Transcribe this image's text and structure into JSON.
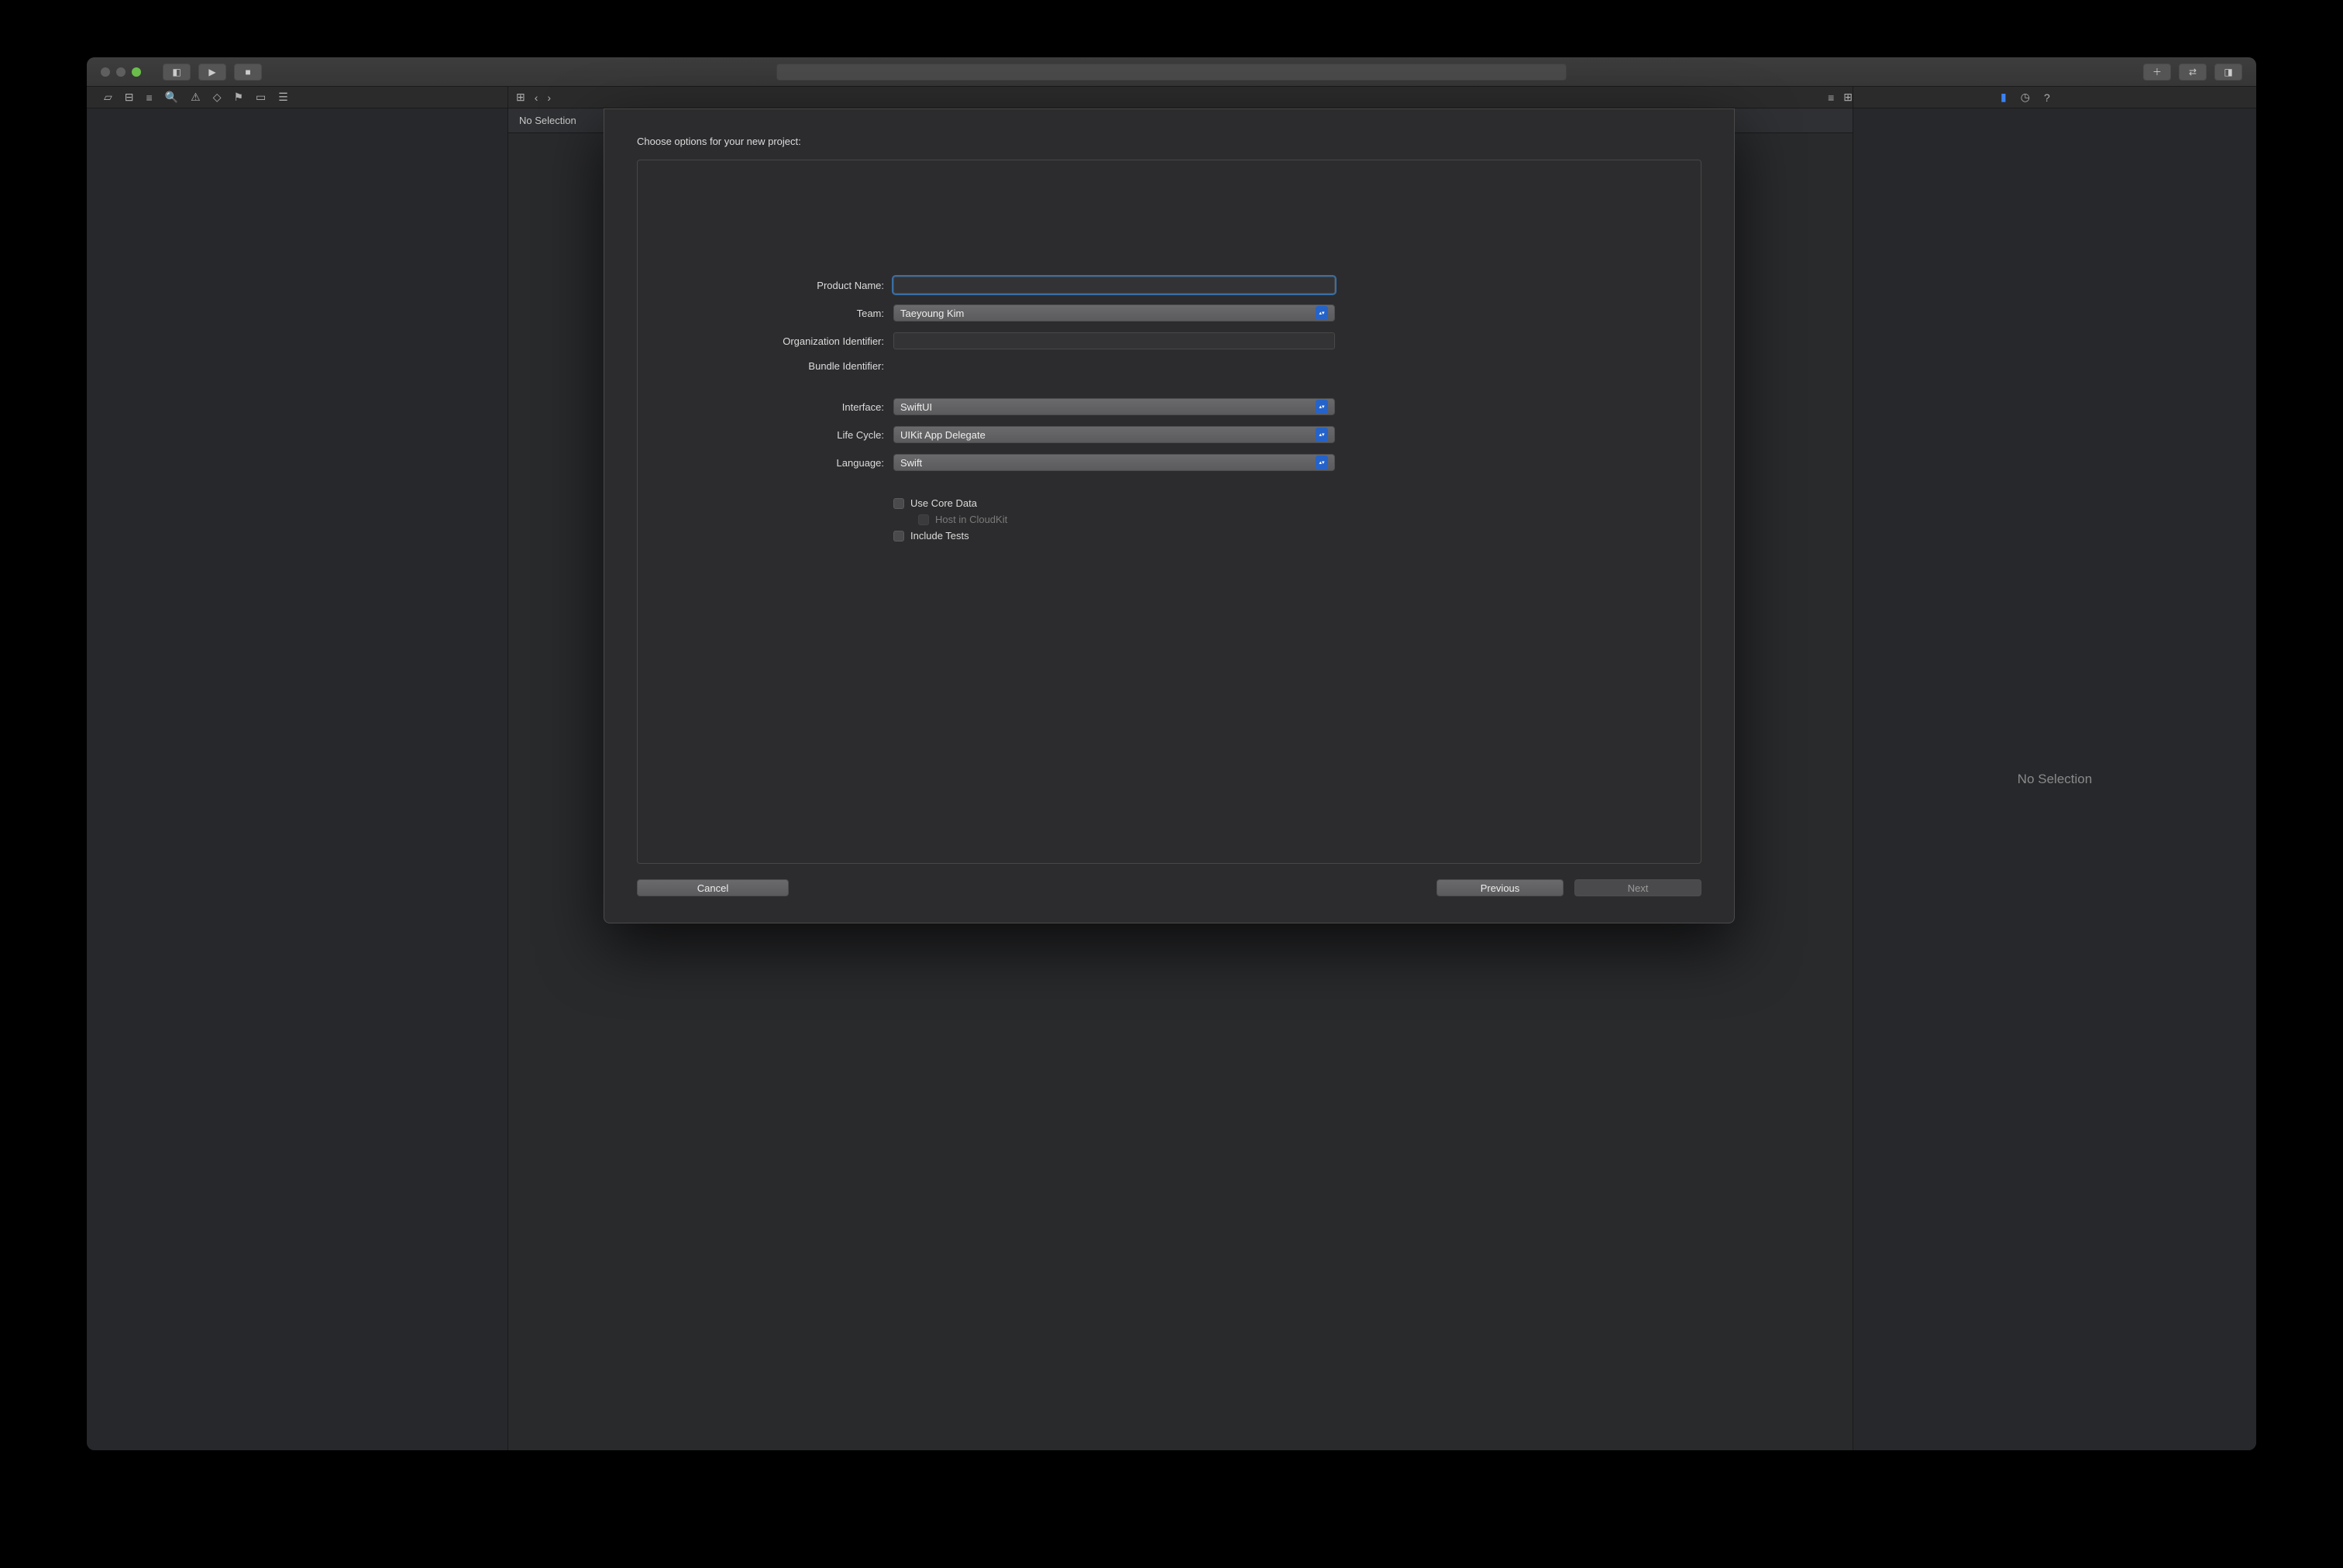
{
  "editor_header": {
    "no_selection": "No Selection"
  },
  "inspector": {
    "no_selection": "No Selection"
  },
  "dialog": {
    "title": "Choose options for your new project:",
    "labels": {
      "product_name": "Product Name:",
      "team": "Team:",
      "org_id": "Organization Identifier:",
      "bundle_id": "Bundle Identifier:",
      "interface": "Interface:",
      "life_cycle": "Life Cycle:",
      "language": "Language:"
    },
    "values": {
      "product_name": "",
      "team": "Taeyoung Kim",
      "org_id": "",
      "bundle_id": "",
      "interface": "SwiftUI",
      "life_cycle": "UIKit App Delegate",
      "language": "Swift"
    },
    "checkboxes": {
      "use_core_data": "Use Core Data",
      "host_cloudkit": "Host in CloudKit",
      "include_tests": "Include Tests"
    },
    "buttons": {
      "cancel": "Cancel",
      "previous": "Previous",
      "next": "Next"
    }
  }
}
